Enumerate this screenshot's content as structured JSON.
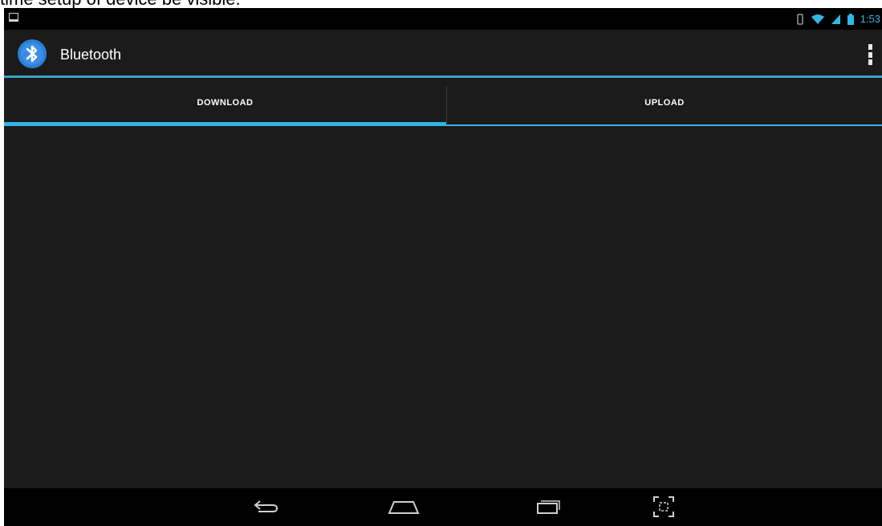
{
  "caption": {
    "text": "time setup of device be visible."
  },
  "status_bar": {
    "time": "1:53",
    "icons": [
      "picture-notification-icon",
      "vibrate-icon",
      "wifi-icon",
      "signal-icon",
      "battery-icon"
    ]
  },
  "action_bar": {
    "title": "Bluetooth",
    "app_icon": "bluetooth-icon",
    "overflow_icon": "overflow-menu-icon"
  },
  "tabs": [
    {
      "label": "DOWNLOAD",
      "selected": true
    },
    {
      "label": "UPLOAD",
      "selected": false
    }
  ],
  "nav_bar": {
    "icons": [
      "back-icon",
      "home-icon",
      "recent-apps-icon",
      "screenshot-icon"
    ]
  },
  "colors": {
    "accent": "#33b5e5",
    "background": "#1b1b1b",
    "bar": "#000000",
    "text": "#ffffff"
  }
}
